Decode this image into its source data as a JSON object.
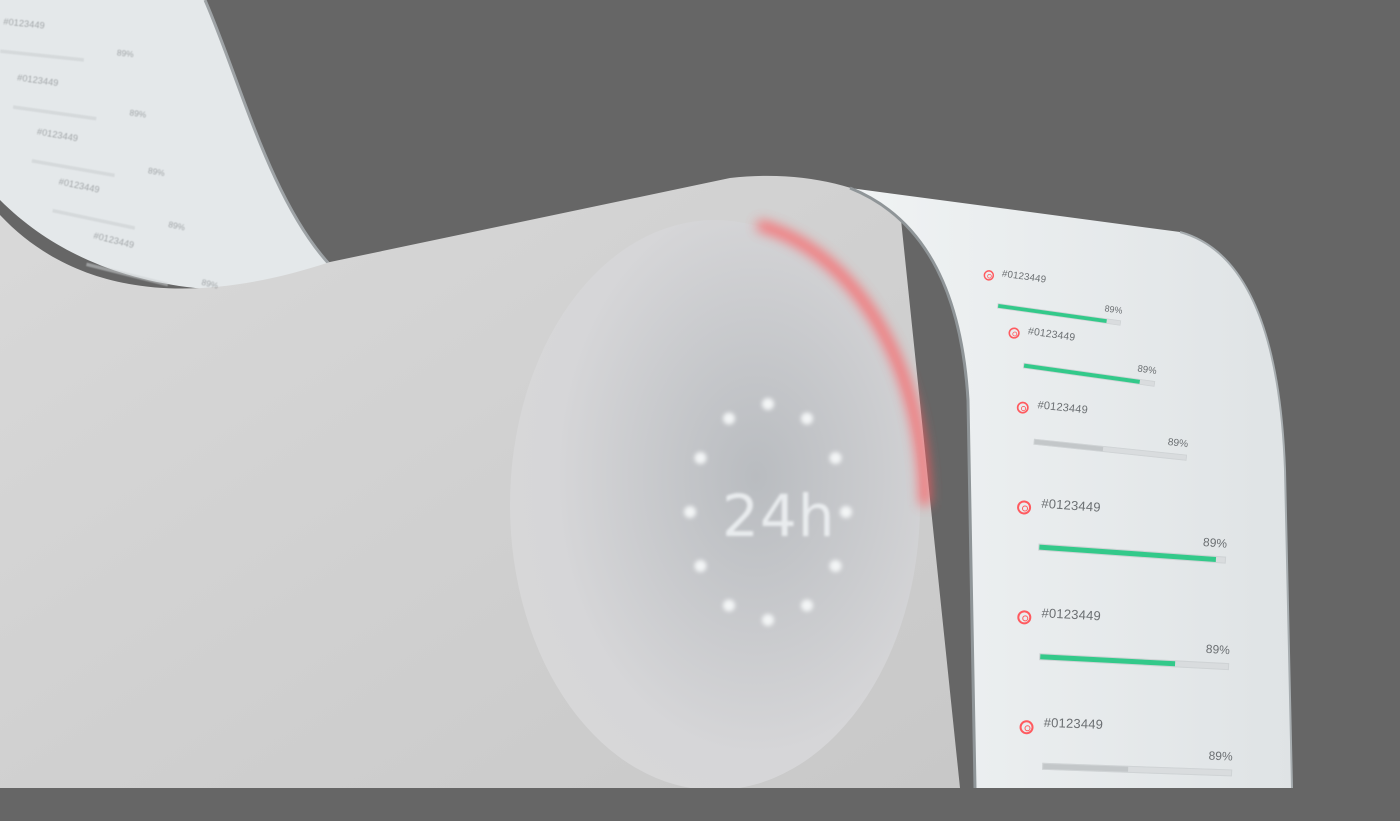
{
  "colors": {
    "background": "#666666",
    "body": "#cfcfcf",
    "panel": "#e3e7e9",
    "accent_green": "#33c98a",
    "accent_red": "#ff5a5f",
    "track": "#d9dcde"
  },
  "dial": {
    "label": "24h",
    "dots": 12
  },
  "side_panel": {
    "items": [
      {
        "id": "#0123449",
        "percent": "89%",
        "progress": 0.89,
        "color": "#33c98a",
        "icon": "target-icon"
      },
      {
        "id": "#0123449",
        "percent": "89%",
        "progress": 0.89,
        "color": "#33c98a",
        "icon": "target-icon"
      },
      {
        "id": "#0123449",
        "percent": "89%",
        "progress": 0.45,
        "color": "#c3c7c9",
        "icon": "target-icon"
      },
      {
        "id": "#0123449",
        "percent": "89%",
        "progress": 0.95,
        "color": "#33c98a",
        "icon": "target-icon"
      },
      {
        "id": "#0123449",
        "percent": "89%",
        "progress": 0.72,
        "color": "#33c98a",
        "icon": "target-icon"
      },
      {
        "id": "#0123449",
        "percent": "89%",
        "progress": 0.45,
        "color": "#c3c7c9",
        "icon": "target-icon"
      }
    ]
  },
  "back_panel": {
    "items": [
      {
        "id": "#0123449",
        "percent": "89%"
      },
      {
        "id": "#0123449",
        "percent": "89%"
      },
      {
        "id": "#0123449",
        "percent": "89%"
      },
      {
        "id": "#0123449",
        "percent": "89%"
      },
      {
        "id": "#0123449",
        "percent": "89%"
      }
    ]
  }
}
